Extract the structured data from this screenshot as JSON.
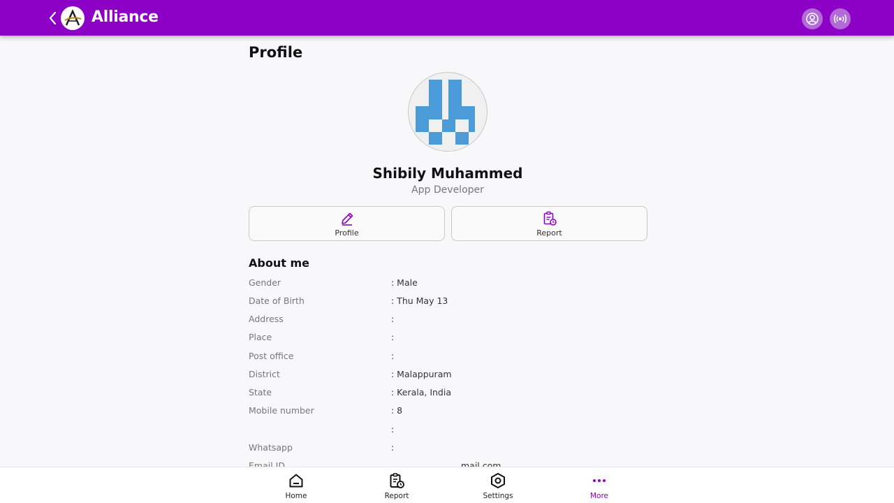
{
  "header": {
    "title": "Alliance",
    "accent": "#8d00c6"
  },
  "page": {
    "title": "Profile"
  },
  "user": {
    "name": "Shibily Muhammed",
    "role": "App Developer"
  },
  "actions": {
    "profile_label": "Profile",
    "report_label": "Report"
  },
  "about": {
    "title": "About me",
    "fields": [
      {
        "label": "Gender",
        "value": ": Male"
      },
      {
        "label": "Date of Birth",
        "value": ": Thu May 13"
      },
      {
        "label": "Address",
        "value": ":"
      },
      {
        "label": "Place",
        "value": ":"
      },
      {
        "label": "Post office",
        "value": ":"
      },
      {
        "label": "District",
        "value": ": Malappuram"
      },
      {
        "label": "State",
        "value": ": Kerala, India"
      },
      {
        "label": "Mobile number",
        "value": ": 8"
      },
      {
        "label": "",
        "value": ":"
      },
      {
        "label": "Whatsapp",
        "value": ":"
      },
      {
        "label": "Email ID",
        "value": "mail.com"
      }
    ]
  },
  "nav": {
    "items": [
      {
        "label": "Home",
        "icon": "home-icon"
      },
      {
        "label": "Report",
        "icon": "report-icon"
      },
      {
        "label": "Settings",
        "icon": "settings-icon"
      },
      {
        "label": "More",
        "icon": "more-icon"
      }
    ],
    "active": "More"
  }
}
